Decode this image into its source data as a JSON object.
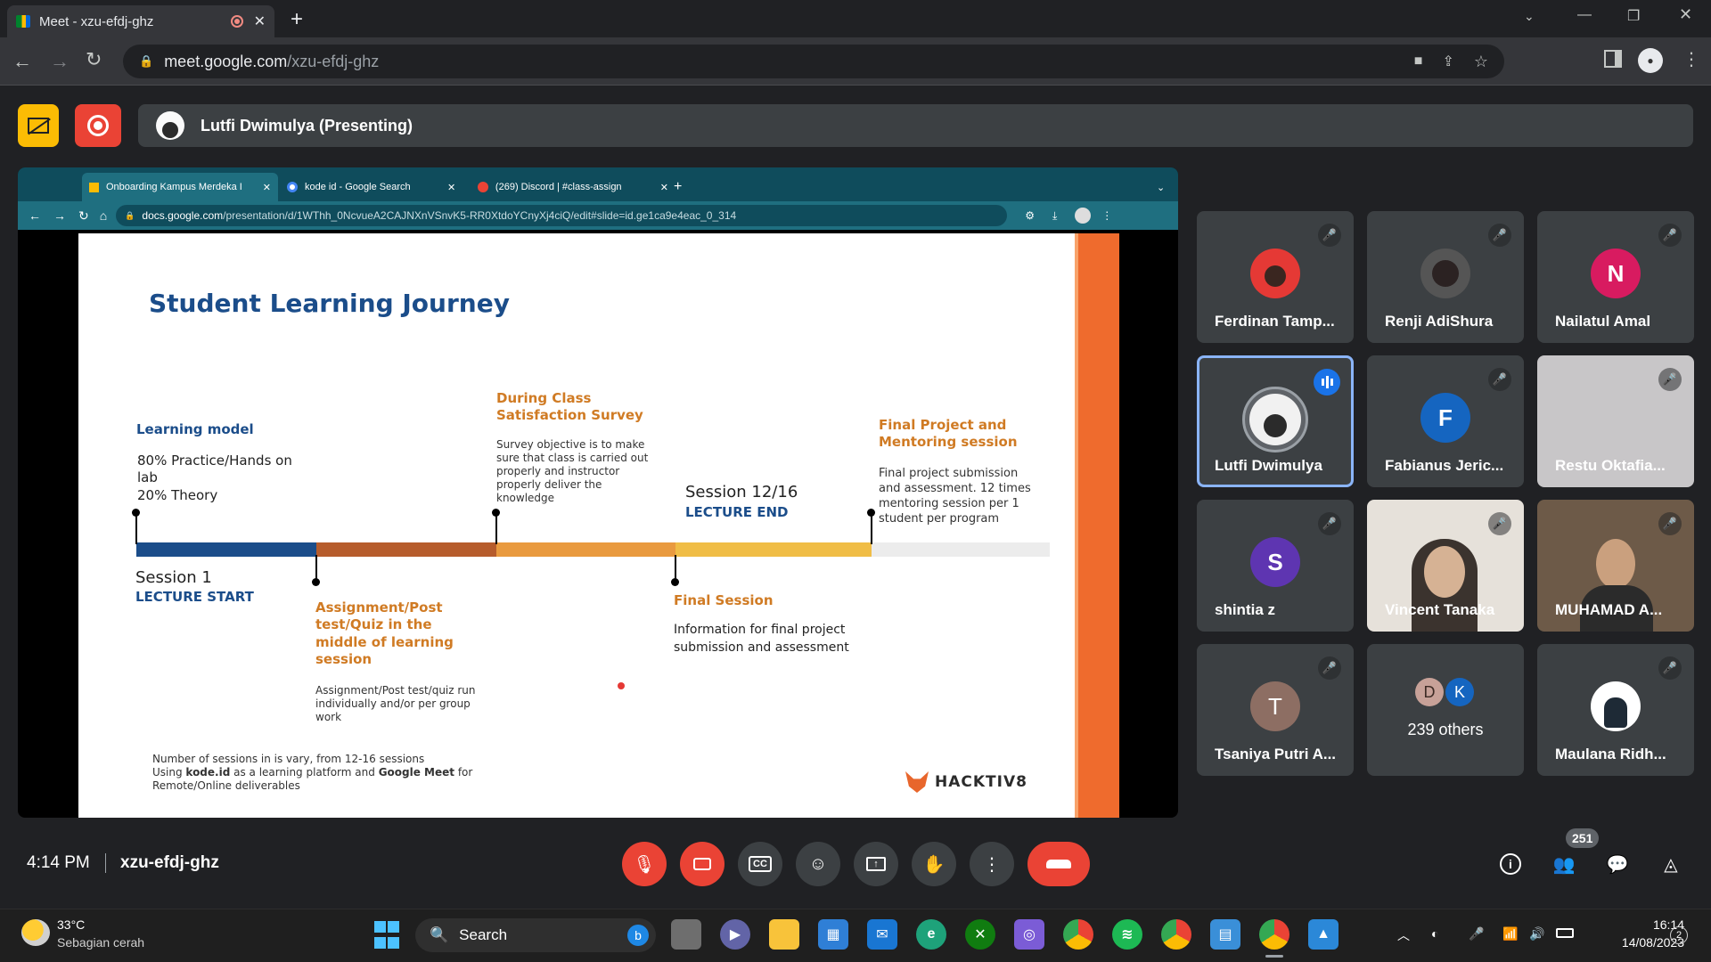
{
  "browser": {
    "tab_title": "Meet - xzu-efdj-ghz",
    "url_host": "meet.google.com",
    "url_path": "/xzu-efdj-ghz"
  },
  "meet": {
    "presenter_label": "Lutfi Dwimulya (Presenting)",
    "time": "4:14 PM",
    "meeting_code": "xzu-efdj-ghz",
    "participant_count": "251"
  },
  "shared_screen": {
    "tabs": [
      "Onboarding Kampus Merdeka I",
      "kode id - Google Search",
      "(269) Discord | #class-assign"
    ],
    "url_host": "docs.google.com",
    "url_path": "/presentation/d/1WThh_0NcvueA2CAJNXnVSnvK5-RR0XtdoYCnyXj4ciQ/edit#slide=id.ge1ca9e4eac_0_314"
  },
  "slide": {
    "title": "Student Learning Journey",
    "learning_model": "Learning model",
    "lm_1": "80% Practice/Hands on",
    "lm_2": "lab",
    "lm_3": "20% Theory",
    "survey_title_1": "During Class",
    "survey_title_2": "Satisfaction Survey",
    "survey_desc": "Survey objective is to make sure that class is carried out properly and instructor properly deliver the knowledge",
    "session_end": "Session 12/16",
    "lecture_end": "LECTURE END",
    "final_title_1": "Final Project and",
    "final_title_2": "Mentoring session",
    "final_desc": "Final project submission and assessment. 12 times mentoring session per 1 student per program",
    "session_start": "Session 1",
    "lecture_start": "LECTURE START",
    "assign_1": "Assignment/Post",
    "assign_2": "test/Quiz in the",
    "assign_3": "middle of learning",
    "assign_4": "session",
    "assign_desc": "Assignment/Post test/quiz run individually and/or per group work",
    "final_session": "Final Session",
    "final_session_desc_1": "Information for final project",
    "final_session_desc_2": "submission and assessment",
    "footer_1": "Number of sessions in is vary, from 12-16 sessions",
    "footer_2a": "Using ",
    "footer_2b": "kode.id",
    "footer_2c": " as a learning platform and ",
    "footer_2d": "Google Meet",
    "footer_2e": " for",
    "footer_3": "Remote/Online deliverables",
    "logo": "HACKTIV8"
  },
  "participants": [
    {
      "name": "Ferdinan Tamp...",
      "initial": "",
      "color": "#e53935"
    },
    {
      "name": "Renji AdiShura",
      "initial": "",
      "color": "#555555"
    },
    {
      "name": "Nailatul Amal",
      "initial": "N",
      "color": "#d81b60"
    },
    {
      "name": "Lutfi Dwimulya",
      "initial": "",
      "color": "#777777"
    },
    {
      "name": "Fabianus Jeric...",
      "initial": "F",
      "color": "#1565c0"
    },
    {
      "name": "Restu Oktafia...",
      "initial": "",
      "color": "#bdbdbd"
    },
    {
      "name": "shintia z",
      "initial": "S",
      "color": "#5e35b1"
    },
    {
      "name": "Vincent Tanaka",
      "initial": "",
      "color": "#d8d2c8"
    },
    {
      "name": "MUHAMAD A...",
      "initial": "",
      "color": "#6d5a48"
    },
    {
      "name": "Tsaniya Putri A...",
      "initial": "T",
      "color": "#8d6e63"
    },
    {
      "name": "239 others",
      "initial": "",
      "color": ""
    },
    {
      "name": "Maulana Ridh...",
      "initial": "",
      "color": "#ffffff"
    }
  ],
  "others_initials": [
    "D",
    "K"
  ],
  "taskbar": {
    "temp": "33°C",
    "weather": "Sebagian cerah",
    "search": "Search",
    "clock": "16:14",
    "date": "14/08/2023",
    "notif": "2"
  }
}
